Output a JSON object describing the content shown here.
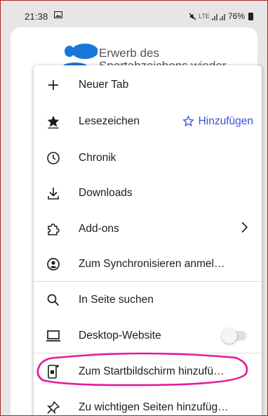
{
  "statusbar": {
    "time": "21:38",
    "network": "LTE",
    "battery": "76%"
  },
  "page": {
    "text_line1": "Erwerb des",
    "text_line2": "Sportabzeichens wieder"
  },
  "menu": {
    "items": [
      {
        "label": "Neuer Tab",
        "icon": "plus-icon"
      },
      {
        "label": "Lesezeichen",
        "icon": "star-filled-icon",
        "action": "Hinzufügen",
        "action_icon": "star-outline-icon"
      },
      {
        "label": "Chronik",
        "icon": "clock-icon"
      },
      {
        "label": "Downloads",
        "icon": "download-icon"
      },
      {
        "label": "Add-ons",
        "icon": "puzzle-icon",
        "chevron": "chevron-right-icon"
      },
      {
        "label": "Zum Synchronisieren anmel…",
        "icon": "account-icon"
      },
      {
        "label": "In Seite suchen",
        "icon": "search-icon"
      },
      {
        "label": "Desktop-Website",
        "icon": "laptop-icon",
        "toggle_on": false
      },
      {
        "label": "Zum Startbildschirm hinzufü…",
        "icon": "add-to-homescreen-icon"
      },
      {
        "label": "Zu wichtigen Seiten hinzufüg…",
        "icon": "pin-icon"
      }
    ]
  },
  "colors": {
    "accent": "#3a4fd8",
    "annotation_circle": "#e6199b",
    "frame_border": "#b32020"
  }
}
